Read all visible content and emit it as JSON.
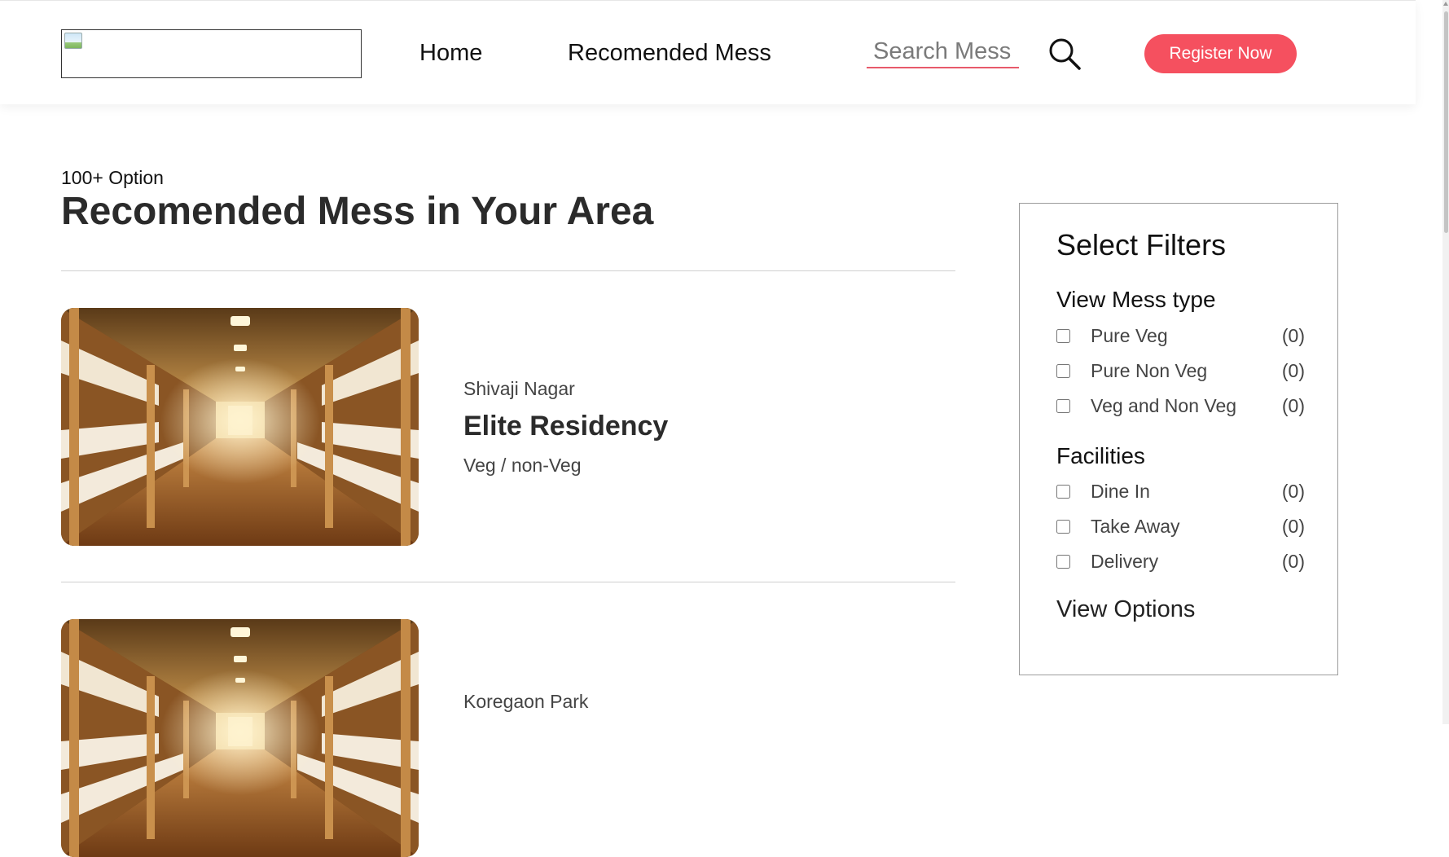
{
  "header": {
    "logo_icon": "broken-image-icon",
    "nav": {
      "home_label": "Home",
      "recommended_label": "Recomended Mess"
    },
    "search": {
      "placeholder": "Search Mess",
      "value": "",
      "icon": "search-icon"
    },
    "register_label": "Register Now",
    "accent_color": "#f5505f"
  },
  "main": {
    "subtitle": "100+ Option",
    "title": "Recomended Mess in Your Area",
    "listings": [
      {
        "area": "Shivaji Nagar",
        "name": "Elite Residency",
        "type": "Veg / non-Veg",
        "image": "dormitory-bunk-beds-photo"
      },
      {
        "area": "Koregaon Park",
        "image": "dormitory-bunk-beds-photo"
      }
    ]
  },
  "filters": {
    "title": "Select Filters",
    "mess_type": {
      "title": "View Mess type",
      "options": [
        {
          "label": "Pure Veg",
          "count": "(0)",
          "checked": false
        },
        {
          "label": "Pure Non Veg",
          "count": "(0)",
          "checked": false
        },
        {
          "label": "Veg and Non Veg",
          "count": "(0)",
          "checked": false
        }
      ]
    },
    "facilities": {
      "title": "Facilities",
      "options": [
        {
          "label": "Dine In",
          "count": "(0)",
          "checked": false
        },
        {
          "label": "Take Away",
          "count": "(0)",
          "checked": false
        },
        {
          "label": "Delivery",
          "count": "(0)",
          "checked": false
        }
      ]
    },
    "view_options_label": "View Options"
  }
}
